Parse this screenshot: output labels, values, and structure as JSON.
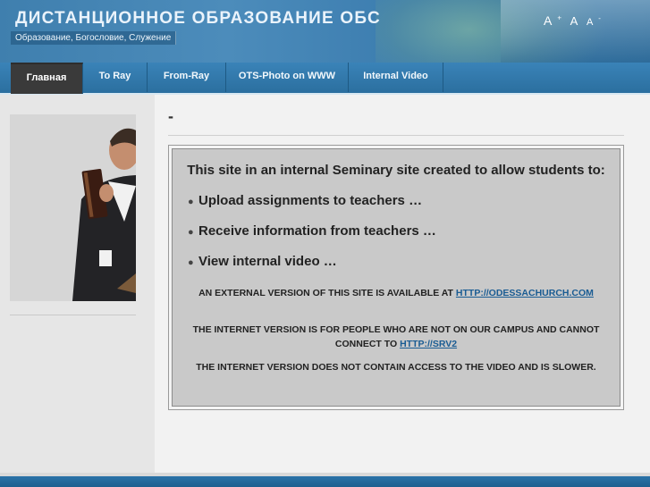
{
  "header": {
    "title": "ДИСТАНЦИОННОЕ ОБРАЗОВАНИЕ ОБС",
    "subtitle": "Образование, Богословие, Служение",
    "font_tools": {
      "large": "A",
      "medium": "A",
      "small": "A",
      "plus": "+",
      "minus": "-"
    }
  },
  "nav": {
    "items": [
      {
        "label": "Главная",
        "active": true
      },
      {
        "label": "To Ray"
      },
      {
        "label": "From-Ray"
      },
      {
        "label": "OTS-Photo on WWW"
      },
      {
        "label": "Internal Video"
      }
    ]
  },
  "main": {
    "page_title": "-",
    "intro": "This site in an internal Seminary site created to allow students to:",
    "bullets": [
      "Upload assignments to teachers …",
      "Receive information from teachers …",
      "View internal video …"
    ],
    "notes": {
      "external_prefix": "AN EXTERNAL VERSION OF THIS SITE IS AVAILABLE AT",
      "external_link": "HTTP://ODESSACHURCH.COM",
      "internet_prefix": "THE INTERNET VERSION IS FOR PEOPLE WHO ARE NOT ON OUR CAMPUS AND CANNOT CONNECT TO",
      "internet_link": "HTTP://SRV2",
      "no_video": "THE INTERNET VERSION DOES NOT CONTAIN ACCESS TO THE VIDEO AND IS SLOWER."
    }
  },
  "colors": {
    "header_blue": "#3f7fae",
    "nav_active": "#3a3a3a",
    "link": "#1a5c93",
    "content_bg": "#c9c9c9"
  }
}
